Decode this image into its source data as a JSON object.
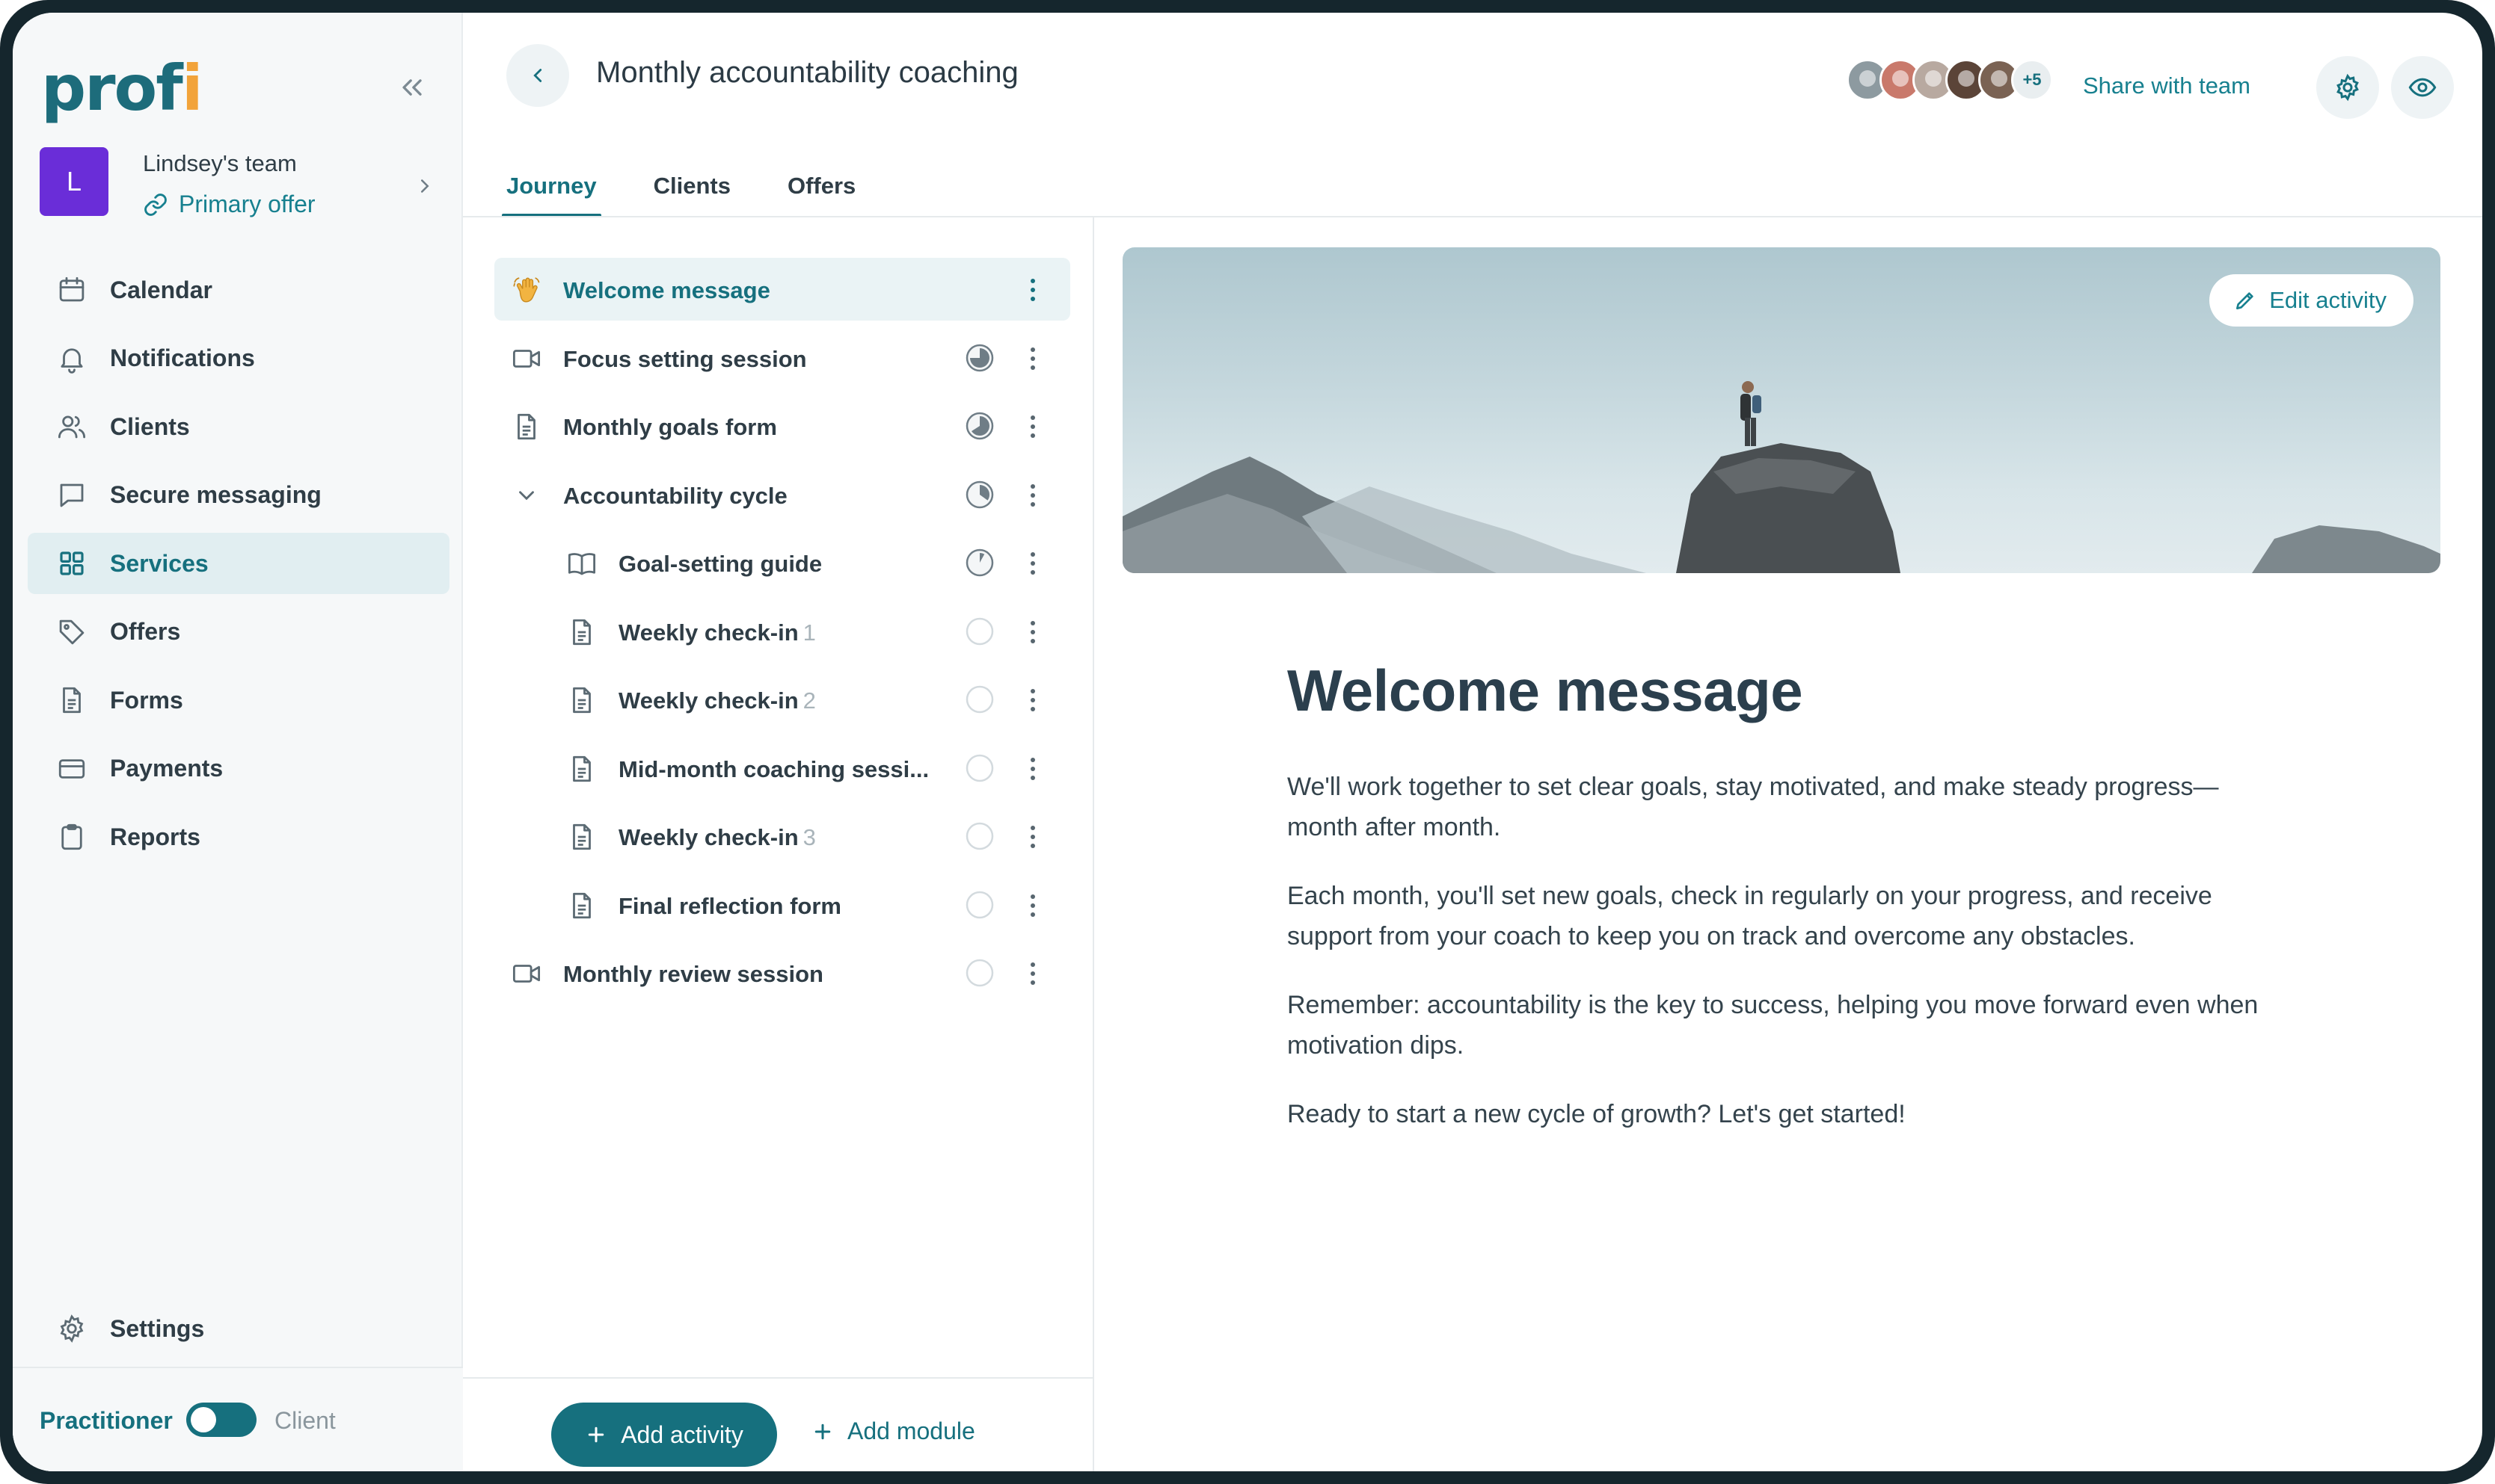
{
  "brand": {
    "logo_text": "prof",
    "logo_dot": "i",
    "accent": "#16707e",
    "logo_accent": "#f2a33a"
  },
  "team": {
    "avatar_letter": "L",
    "name": "Lindsey's team",
    "offer_link": "Primary offer",
    "avatar_color": "#6a2dd8"
  },
  "nav": {
    "items": [
      {
        "label": "Calendar",
        "icon": "calendar-icon"
      },
      {
        "label": "Notifications",
        "icon": "bell-icon"
      },
      {
        "label": "Clients",
        "icon": "users-icon"
      },
      {
        "label": "Secure messaging",
        "icon": "message-icon"
      },
      {
        "label": "Services",
        "icon": "grid-icon",
        "active": true
      },
      {
        "label": "Offers",
        "icon": "tag-icon"
      },
      {
        "label": "Forms",
        "icon": "document-icon"
      },
      {
        "label": "Payments",
        "icon": "credit-card-icon"
      },
      {
        "label": "Reports",
        "icon": "clipboard-icon"
      }
    ],
    "settings_label": "Settings"
  },
  "mode": {
    "left": "Practitioner",
    "right": "Client",
    "practitioner_on": true
  },
  "header": {
    "title": "Monthly accountability coaching",
    "more_count": "+5",
    "share_label": "Share with team",
    "avatar_colors": [
      "#8d9aa0",
      "#c9796b",
      "#b8a9a0",
      "#5b4438",
      "#7a6253"
    ]
  },
  "tabs": [
    {
      "label": "Journey",
      "active": true
    },
    {
      "label": "Clients"
    },
    {
      "label": "Offers"
    }
  ],
  "journey": [
    {
      "label": "Welcome message",
      "icon": "wave-hand-icon",
      "active": true,
      "progress": null
    },
    {
      "label": "Focus setting session",
      "icon": "video-icon",
      "progress": 0.75
    },
    {
      "label": "Monthly goals form",
      "icon": "document-icon",
      "progress": 0.66
    },
    {
      "label": "Accountability cycle",
      "icon": "chevron-down-icon",
      "progress": 0.35
    },
    {
      "label": "Goal-setting guide",
      "num": "",
      "icon": "book-icon",
      "child": true,
      "progress": 0.08
    },
    {
      "label": "Weekly check-in",
      "num": "1",
      "icon": "document-icon",
      "child": true,
      "progress": 0
    },
    {
      "label": "Weekly check-in",
      "num": "2",
      "icon": "document-icon",
      "child": true,
      "progress": 0
    },
    {
      "label": "Mid-month coaching sessi...",
      "num": "",
      "icon": "document-icon",
      "child": true,
      "progress": 0
    },
    {
      "label": "Weekly check-in",
      "num": "3",
      "icon": "document-icon",
      "child": true,
      "progress": 0
    },
    {
      "label": "Final reflection form",
      "num": "",
      "icon": "document-icon",
      "child": true,
      "progress": 0
    },
    {
      "label": "Monthly review session",
      "icon": "video-icon",
      "progress": 0
    }
  ],
  "footer": {
    "add_activity": "Add activity",
    "add_module": "Add module"
  },
  "content": {
    "edit_label": "Edit activity",
    "heading": "Welcome message",
    "paragraphs": [
      "We'll work together to set clear goals, stay motivated, and make steady progress—month after month.",
      "Each month, you'll set new goals, check in regularly on your progress, and receive support from your coach to keep you on track and overcome any obstacles.",
      "Remember: accountability is the key to success, helping you move forward even when motivation dips.",
      "Ready to start a new cycle of growth? Let's get started!"
    ]
  }
}
